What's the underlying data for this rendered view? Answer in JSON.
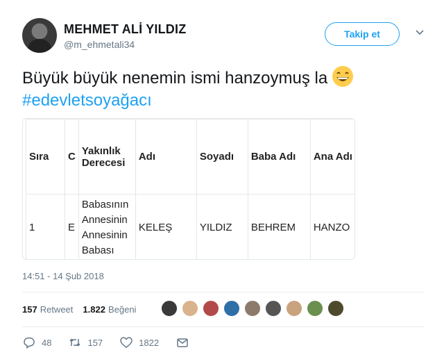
{
  "user": {
    "name": "MEHMET ALİ YILDIZ",
    "handle": "@m_ehmetali34",
    "follow_label": "Takip et"
  },
  "tweet": {
    "text": "Büyük büyük nenemin ismi hanzoymuş la",
    "hashtag": "#edevletsoyağacı",
    "emoji": "grinning-face-icon"
  },
  "table": {
    "headers": [
      "Sıra",
      "C",
      "Yakınlık Derecesi",
      "Adı",
      "Soyadı",
      "Baba Adı",
      "Ana Adı"
    ],
    "rows": [
      [
        "1",
        "E",
        "Babasının Annesinin Annesinin Babası",
        "KELEŞ",
        "YILDIZ",
        "BEHREM",
        "HANZO"
      ]
    ]
  },
  "timestamp": "14:51 - 14 Şub 2018",
  "stats": {
    "retweet_count": "157",
    "retweet_label": "Retweet",
    "like_count": "1.822",
    "like_label": "Beğeni"
  },
  "actions": {
    "reply_count": "48",
    "retweet_count": "157",
    "like_count": "1822"
  },
  "colors": {
    "accent": "#1da1f2",
    "muted": "#657786"
  }
}
